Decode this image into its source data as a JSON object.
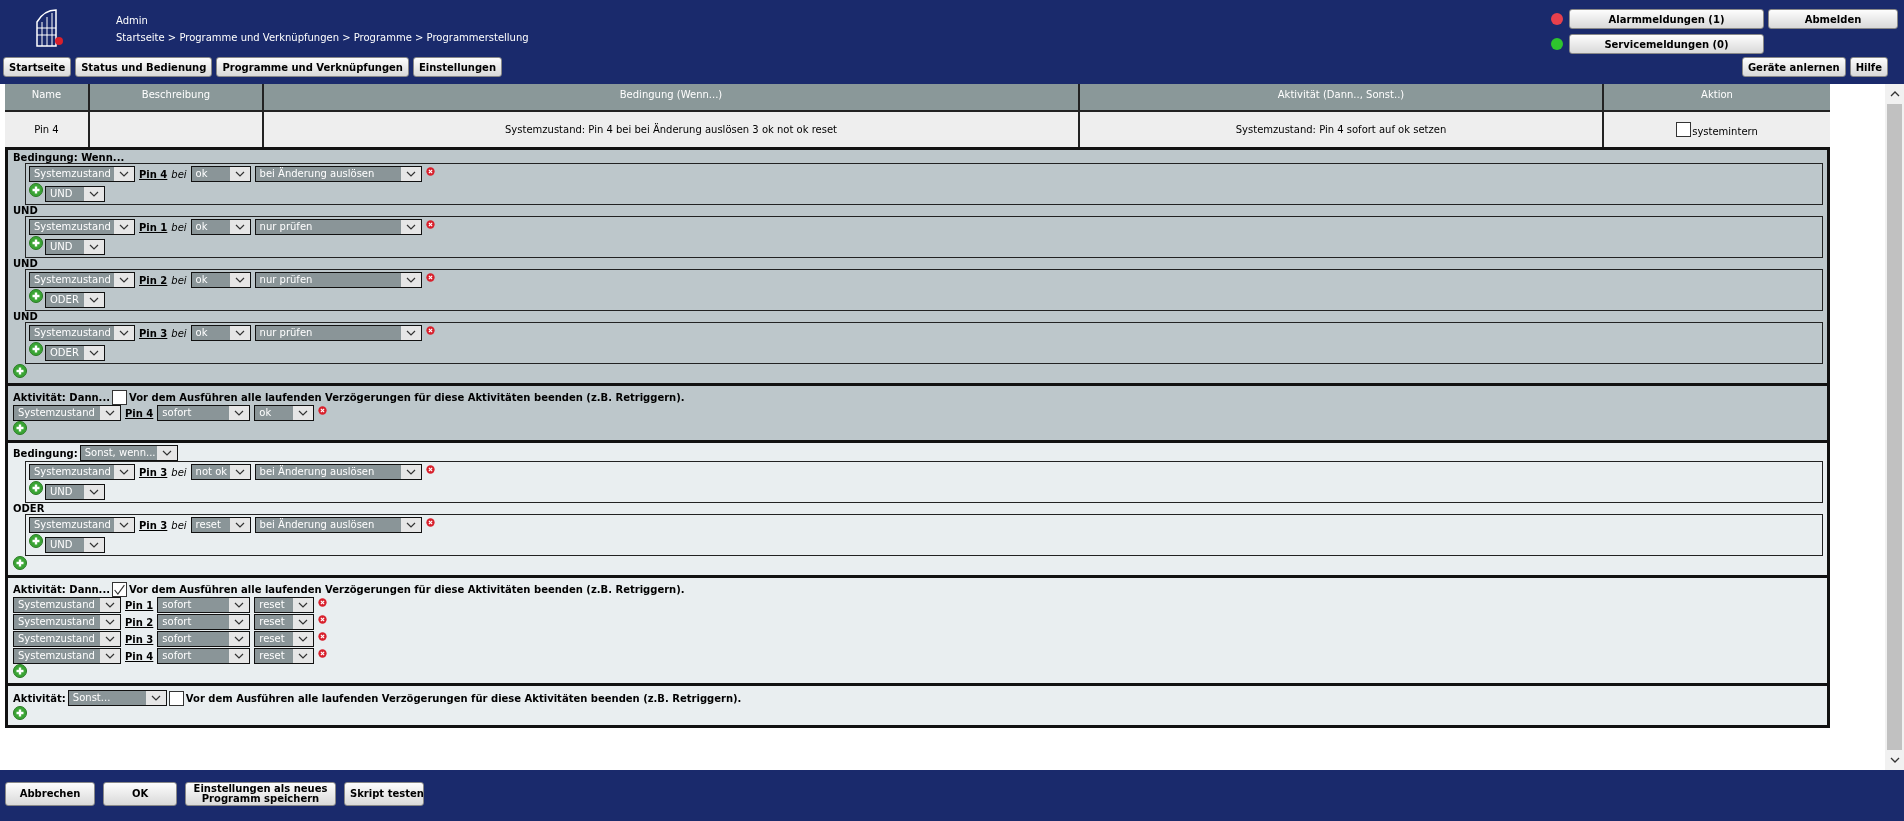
{
  "header": {
    "user": "Admin",
    "breadcrumb": "Startseite > Programme und Verknüpfungen > Programme > Programmerstellung",
    "nav": [
      "Startseite",
      "Status und Bedienung",
      "Programme und Verknüpfungen",
      "Einstellungen"
    ],
    "messages": [
      {
        "label": "Alarmmeldungen (1)",
        "color": "#e8404c"
      },
      {
        "label": "Servicemeldungen (0)",
        "color": "#2ec42e"
      }
    ],
    "logout": "Abmelden",
    "tools": [
      "Geräte anlernen",
      "Hilfe"
    ]
  },
  "table": {
    "columns": [
      "Name",
      "Beschreibung",
      "Bedingung (Wenn...)",
      "Aktivität (Dann.., Sonst..)",
      "Aktion"
    ],
    "rows": [
      {
        "name": "Pin 4",
        "condition": "Systemzustand: Pin 4 bei bei Änderung auslösen 3 ok not ok reset",
        "activity": "Systemzustand: Pin 4 sofort auf ok setzen",
        "systemintern": false,
        "systemintern_label": "systemintern"
      }
    ]
  },
  "sections": [
    {
      "kind": "condition",
      "color": "#bdc7cb",
      "label": "Bedingung: Wenn...",
      "groups": [
        {
          "source": "Systemzustand",
          "pin": "Pin 4",
          "bei": "bei",
          "value": "ok",
          "trigger": "bei Änderung auslösen",
          "operator": "UND"
        },
        {
          "joiner": "UND",
          "source": "Systemzustand",
          "pin": "Pin 1",
          "bei": "bei",
          "value": "ok",
          "trigger": "nur prüfen",
          "operator": "UND"
        },
        {
          "joiner": "UND",
          "source": "Systemzustand",
          "pin": "Pin 2",
          "bei": "bei",
          "value": "ok",
          "trigger": "nur prüfen",
          "operator": "ODER"
        },
        {
          "joiner": "UND",
          "source": "Systemzustand",
          "pin": "Pin 3",
          "bei": "bei",
          "value": "ok",
          "trigger": "nur prüfen",
          "operator": "ODER"
        }
      ]
    },
    {
      "kind": "activity",
      "color": "#bdc7cb",
      "label": "Aktivität: Dann...",
      "retrigger": false,
      "retrigger_text": "Vor dem Ausführen alle laufenden Verzögerungen für diese Aktivitäten beenden (z.B. Retriggern).",
      "actions": [
        {
          "source": "Systemzustand",
          "pin": "Pin 4",
          "timing": "sofort",
          "value": "ok"
        }
      ]
    },
    {
      "kind": "condition",
      "color": "#e9eef0",
      "label": "Bedingung:",
      "mode": "Sonst, wenn...",
      "groups": [
        {
          "source": "Systemzustand",
          "pin": "Pin 3",
          "bei": "bei",
          "value": "not ok",
          "trigger": "bei Änderung auslösen",
          "operator": "UND"
        },
        {
          "joiner": "ODER",
          "source": "Systemzustand",
          "pin": "Pin 3",
          "bei": "bei",
          "value": "reset",
          "trigger": "bei Änderung auslösen",
          "operator": "UND"
        }
      ]
    },
    {
      "kind": "activity",
      "color": "#e9eef0",
      "label": "Aktivität: Dann...",
      "retrigger": true,
      "retrigger_text": "Vor dem Ausführen alle laufenden Verzögerungen für diese Aktivitäten beenden (z.B. Retriggern).",
      "actions": [
        {
          "source": "Systemzustand",
          "pin": "Pin 1",
          "timing": "sofort",
          "value": "reset"
        },
        {
          "source": "Systemzustand",
          "pin": "Pin 2",
          "timing": "sofort",
          "value": "reset"
        },
        {
          "source": "Systemzustand",
          "pin": "Pin 3",
          "timing": "sofort",
          "value": "reset"
        },
        {
          "source": "Systemzustand",
          "pin": "Pin 4",
          "timing": "sofort",
          "value": "reset"
        }
      ]
    },
    {
      "kind": "activity",
      "color": "#e9eef0",
      "label": "Aktivität:",
      "mode": "Sonst...",
      "retrigger": false,
      "retrigger_text": "Vor dem Ausführen alle laufenden Verzögerungen für diese Aktivitäten beenden (z.B. Retriggern)."
    }
  ],
  "footer": {
    "buttons": [
      "Abbrechen",
      "OK",
      "Einstellungen als neues Programm speichern",
      "Skript testen"
    ]
  }
}
